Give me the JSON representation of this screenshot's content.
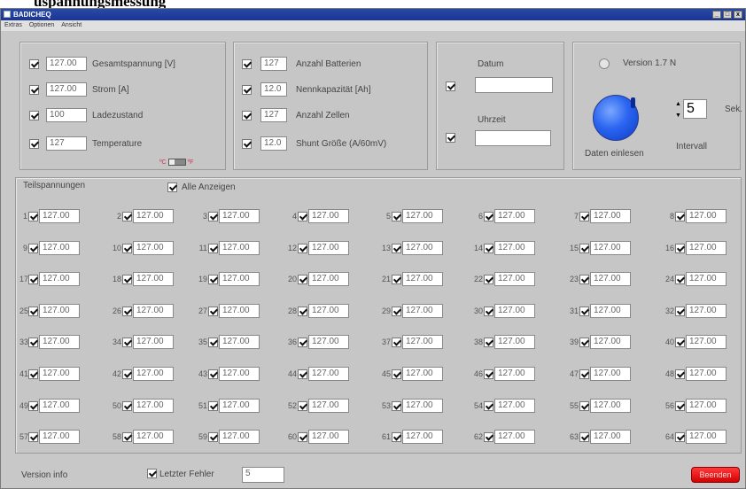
{
  "heading": "uspannungsmessung",
  "window": {
    "title": "BADICHEQ",
    "buttons": [
      "_",
      "□",
      "x"
    ]
  },
  "menu": [
    "Extras",
    "Optionen",
    "Ansicht"
  ],
  "measurements": [
    {
      "value": "127.00",
      "label": "Gesamtspannung [V]",
      "checked": true
    },
    {
      "value": "127.00",
      "label": "Strom [A]",
      "checked": true
    },
    {
      "value": "100",
      "label": "Ladezustand",
      "checked": true
    },
    {
      "value": "127",
      "label": "Temperature",
      "checked": true
    }
  ],
  "unit_toggle": {
    "left": "ºC",
    "right": "ºF"
  },
  "battery": [
    {
      "value": "127",
      "label": "Anzahl Batterien",
      "checked": true
    },
    {
      "value": "12.0",
      "label": "Nennkapazität [Ah]",
      "checked": true
    },
    {
      "value": "127",
      "label": "Anzahl Zellen",
      "checked": true
    },
    {
      "value": "12.0",
      "label": "Shunt Größe (A/60mV)",
      "checked": true
    }
  ],
  "datetime": {
    "date_label": "Datum",
    "date_value": "",
    "time_label": "Uhrzeit",
    "time_value": ""
  },
  "version_panel": {
    "version_label": "Version 1.7 N",
    "read_label": "Daten einlesen",
    "interval_value": "5",
    "interval_unit": "Sek.",
    "interval_label": "Intervall",
    "spin_up": "▲",
    "spin_down": "▼"
  },
  "cells_panel": {
    "title": "Teilspannungen",
    "show_all_label": "Alle Anzeigen",
    "cells": [
      {
        "num": "1",
        "value": "127.00"
      },
      {
        "num": "2",
        "value": "127.00"
      },
      {
        "num": "3",
        "value": "127.00"
      },
      {
        "num": "4",
        "value": "127.00"
      },
      {
        "num": "5",
        "value": "127.00"
      },
      {
        "num": "6",
        "value": "127.00"
      },
      {
        "num": "7",
        "value": "127.00"
      },
      {
        "num": "8",
        "value": "127.00"
      },
      {
        "num": "9",
        "value": "127.00"
      },
      {
        "num": "10",
        "value": "127.00"
      },
      {
        "num": "11",
        "value": "127.00"
      },
      {
        "num": "12",
        "value": "127.00"
      },
      {
        "num": "13",
        "value": "127.00"
      },
      {
        "num": "14",
        "value": "127.00"
      },
      {
        "num": "15",
        "value": "127.00"
      },
      {
        "num": "16",
        "value": "127.00"
      },
      {
        "num": "17",
        "value": "127.00"
      },
      {
        "num": "18",
        "value": "127.00"
      },
      {
        "num": "19",
        "value": "127.00"
      },
      {
        "num": "20",
        "value": "127.00"
      },
      {
        "num": "21",
        "value": "127.00"
      },
      {
        "num": "22",
        "value": "127.00"
      },
      {
        "num": "23",
        "value": "127.00"
      },
      {
        "num": "24",
        "value": "127.00"
      },
      {
        "num": "25",
        "value": "127.00"
      },
      {
        "num": "26",
        "value": "127.00"
      },
      {
        "num": "27",
        "value": "127.00"
      },
      {
        "num": "28",
        "value": "127.00"
      },
      {
        "num": "29",
        "value": "127.00"
      },
      {
        "num": "30",
        "value": "127.00"
      },
      {
        "num": "31",
        "value": "127.00"
      },
      {
        "num": "32",
        "value": "127.00"
      },
      {
        "num": "33",
        "value": "127.00"
      },
      {
        "num": "34",
        "value": "127.00"
      },
      {
        "num": "35",
        "value": "127.00"
      },
      {
        "num": "36",
        "value": "127.00"
      },
      {
        "num": "37",
        "value": "127.00"
      },
      {
        "num": "38",
        "value": "127.00"
      },
      {
        "num": "39",
        "value": "127.00"
      },
      {
        "num": "40",
        "value": "127.00"
      },
      {
        "num": "41",
        "value": "127.00"
      },
      {
        "num": "42",
        "value": "127.00"
      },
      {
        "num": "43",
        "value": "127.00"
      },
      {
        "num": "44",
        "value": "127.00"
      },
      {
        "num": "45",
        "value": "127.00"
      },
      {
        "num": "46",
        "value": "127.00"
      },
      {
        "num": "47",
        "value": "127.00"
      },
      {
        "num": "48",
        "value": "127.00"
      },
      {
        "num": "49",
        "value": "127.00"
      },
      {
        "num": "50",
        "value": "127.00"
      },
      {
        "num": "51",
        "value": "127.00"
      },
      {
        "num": "52",
        "value": "127.00"
      },
      {
        "num": "53",
        "value": "127.00"
      },
      {
        "num": "54",
        "value": "127.00"
      },
      {
        "num": "55",
        "value": "127.00"
      },
      {
        "num": "56",
        "value": "127.00"
      },
      {
        "num": "57",
        "value": "127.00"
      },
      {
        "num": "58",
        "value": "127.00"
      },
      {
        "num": "59",
        "value": "127.00"
      },
      {
        "num": "60",
        "value": "127.00"
      },
      {
        "num": "61",
        "value": "127.00"
      },
      {
        "num": "62",
        "value": "127.00"
      },
      {
        "num": "63",
        "value": "127.00"
      },
      {
        "num": "64",
        "value": "127.00"
      }
    ]
  },
  "footer": {
    "version_info": "Version info",
    "last_error_label": "Letzter Fehler",
    "last_error_value": "5",
    "exit_label": "Beenden"
  },
  "colors": {
    "window_bg": "#c8c8c8",
    "titlebar": "#1a3594",
    "knob": "#2a64f0",
    "exit_button": "#e00000"
  }
}
